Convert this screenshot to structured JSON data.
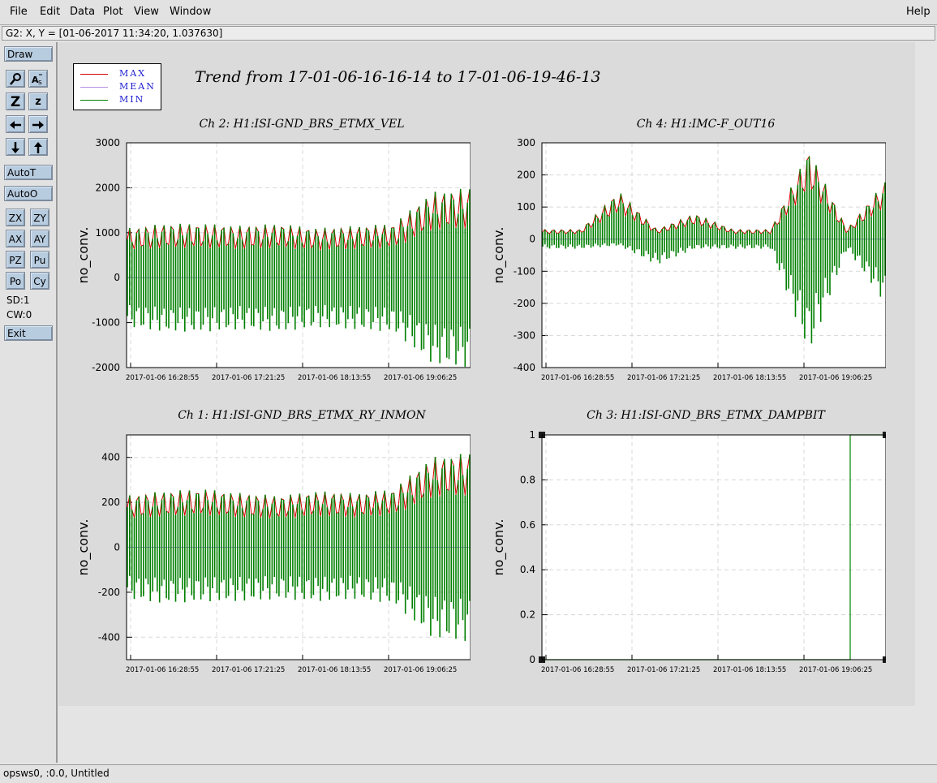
{
  "menu": {
    "file": "File",
    "edit": "Edit",
    "data": "Data",
    "plot": "Plot",
    "view": "View",
    "window": "Window",
    "help": "Help"
  },
  "status": "G2: X, Y = [01-06-2017 11:34:20, 1.037630]",
  "sidebar": {
    "draw": "Draw",
    "zoom_big": "Z",
    "zoom_small": "z",
    "autot": "AutoT",
    "autoo": "AutoO",
    "zx": "ZX",
    "zy": "ZY",
    "ax": "AX",
    "ay": "AY",
    "pz": "PZ",
    "pu": "Pu",
    "po": "Po",
    "cy": "Cy",
    "sd": "SD:1",
    "cw": "CW:0",
    "exit": "Exit"
  },
  "title": "Trend from 17-01-06-16-16-14 to 17-01-06-19-46-13",
  "legend": [
    {
      "label": "MAX",
      "color": "#d40000"
    },
    {
      "label": "MEAN",
      "color": "#b090e0"
    },
    {
      "label": "MIN",
      "color": "#008000"
    }
  ],
  "x_ticks": [
    "2017-01-06 16:28:55",
    "2017-01-06 17:21:25",
    "2017-01-06 18:13:55",
    "2017-01-06 19:06:25"
  ],
  "chart_data": [
    {
      "type": "line",
      "title": "Ch 2: H1:ISI-GND_BRS_ETMX_VEL",
      "ylabel": "no_conv.",
      "ylim": [
        -2000,
        3000
      ],
      "yticks": [
        -2000,
        -1000,
        0,
        1000,
        2000,
        3000
      ],
      "series": [
        {
          "name": "MAX",
          "values": [
            1100,
            1200,
            1200,
            1150,
            1200,
            1100,
            1150,
            1200,
            1900,
            2000
          ]
        },
        {
          "name": "MEAN",
          "values": [
            0,
            0,
            0,
            0,
            0,
            0,
            0,
            0,
            0,
            0
          ]
        },
        {
          "name": "MIN",
          "values": [
            -1100,
            -1200,
            -1200,
            -1150,
            -1200,
            -1100,
            -1150,
            -1200,
            -1900,
            -2000
          ]
        }
      ]
    },
    {
      "type": "line",
      "title": "Ch 4: H1:IMC-F_OUT16",
      "ylabel": "no_conv.",
      "ylim": [
        -400,
        300
      ],
      "yticks": [
        -400,
        -300,
        -200,
        -100,
        0,
        100,
        200,
        300
      ],
      "series": [
        {
          "name": "MAX",
          "values": [
            30,
            30,
            150,
            30,
            80,
            30,
            30,
            280,
            30,
            180
          ]
        },
        {
          "name": "MEAN",
          "values": [
            0,
            0,
            0,
            0,
            0,
            0,
            0,
            0,
            0,
            0
          ]
        },
        {
          "name": "MIN",
          "values": [
            -30,
            -30,
            -20,
            -80,
            -30,
            -30,
            -30,
            -360,
            -30,
            -200
          ]
        }
      ]
    },
    {
      "type": "line",
      "title": "Ch 1: H1:ISI-GND_BRS_ETMX_RY_INMON",
      "ylabel": "no_conv.",
      "ylim": [
        -500,
        500
      ],
      "yticks": [
        -400,
        -200,
        0,
        200,
        400
      ],
      "series": [
        {
          "name": "MAX",
          "values": [
            230,
            250,
            260,
            240,
            230,
            250,
            240,
            260,
            400,
            420
          ]
        },
        {
          "name": "MEAN",
          "values": [
            0,
            0,
            0,
            0,
            0,
            0,
            0,
            0,
            0,
            0
          ]
        },
        {
          "name": "MIN",
          "values": [
            -230,
            -250,
            -240,
            -240,
            -230,
            -240,
            -230,
            -250,
            -400,
            -420
          ]
        }
      ]
    },
    {
      "type": "line",
      "title": "Ch 3: H1:ISI-GND_BRS_ETMX_DAMPBIT",
      "ylabel": "no_conv.",
      "ylim": [
        0,
        1
      ],
      "yticks": [
        0,
        0.2,
        0.4,
        0.6,
        0.8,
        1
      ],
      "series": [
        {
          "name": "MIN",
          "values": [
            0,
            0,
            0,
            0,
            0,
            0,
            0,
            0,
            0,
            1
          ]
        }
      ]
    }
  ],
  "bottom_status": "opsws0, :0.0, Untitled"
}
